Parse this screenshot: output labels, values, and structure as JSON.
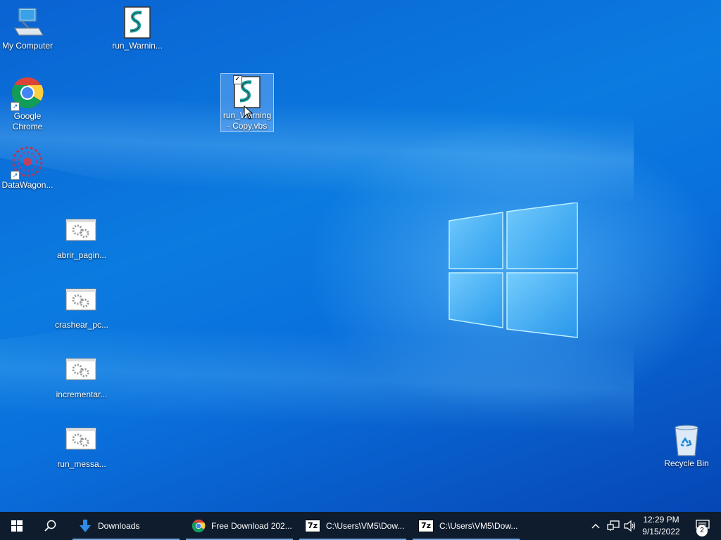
{
  "desktop": {
    "icons": [
      {
        "label": "My Computer"
      },
      {
        "label": "run_Warnin..."
      },
      {
        "label": "Google Chrome"
      },
      {
        "label": "run_Warning - Copy.vbs"
      },
      {
        "label": "DataWagon..."
      },
      {
        "label": "abrir_pagin..."
      },
      {
        "label": "crashear_pc..."
      },
      {
        "label": "incrementar..."
      },
      {
        "label": "run_messa..."
      },
      {
        "label": "Recycle Bin"
      }
    ]
  },
  "taskbar": {
    "tasks": [
      {
        "label": "Downloads",
        "icon": "download-arrow-icon"
      },
      {
        "label": "Free Download 202...",
        "icon": "chrome-icon"
      },
      {
        "label": "C:\\Users\\VM5\\Dow...",
        "icon": "7zip-icon",
        "icon_text": "7z"
      },
      {
        "label": "C:\\Users\\VM5\\Dow...",
        "icon": "7zip-icon",
        "icon_text": "7z"
      }
    ],
    "clock": {
      "time": "12:29 PM",
      "date": "9/15/2022"
    },
    "notification_count": "2"
  },
  "colors": {
    "taskbar": "#0f1c2d",
    "desktop_accent": "#0a6fd6"
  }
}
